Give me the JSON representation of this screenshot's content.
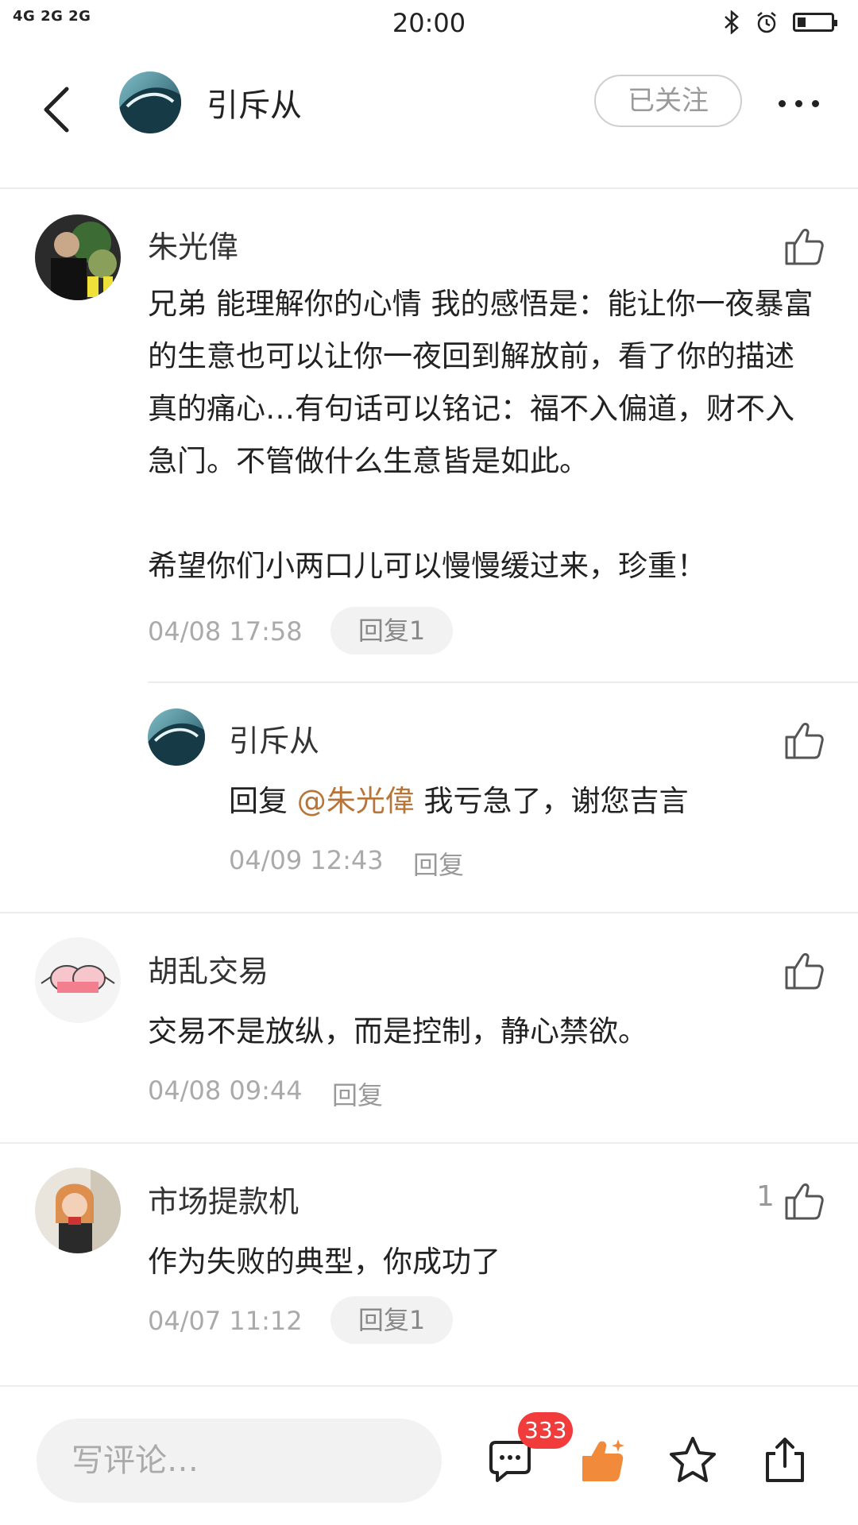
{
  "status_bar": {
    "signal_text": "4G 2G 2G",
    "time": "20:00",
    "battery_level": 0.25,
    "icons": [
      "bluetooth-icon",
      "alarm-icon",
      "battery-icon"
    ]
  },
  "header": {
    "name": "引斥从",
    "follow_label": "已关注",
    "icons": [
      "back-icon",
      "more-icon"
    ]
  },
  "comments": [
    {
      "name": "朱光偉",
      "text": "兄弟 能理解你的心情 我的感悟是：能让你一夜暴富的生意也可以让你一夜回到解放前，看了你的描述真的痛心…有句话可以铭记：福不入偏道，财不入急门。不管做什么生意皆是如此。",
      "text2": "希望你们小两口儿可以慢慢缓过来，珍重！",
      "time": "04/08 17:58",
      "reply_label": "回复1",
      "likes": ""
    },
    {
      "name": "引斥从",
      "reply_prefix": "回复 ",
      "mention": "@朱光偉",
      "text": " 我亏急了，谢您吉言",
      "time": "04/09 12:43",
      "reply_label": "回复"
    },
    {
      "name": "胡乱交易",
      "text": "交易不是放纵，而是控制，静心禁欲。",
      "time": "04/08 09:44",
      "reply_label": "回复"
    },
    {
      "name": "市场提款机",
      "text": "作为失败的典型，你成功了",
      "time": "04/07 11:12",
      "reply_label": "回复1",
      "likes": "1"
    }
  ],
  "bottom_bar": {
    "input_placeholder": "写评论…",
    "comment_count": "333",
    "icons": [
      "comment-icon",
      "like-icon",
      "star-icon",
      "share-icon"
    ],
    "accent_color": "#f28a3c"
  }
}
